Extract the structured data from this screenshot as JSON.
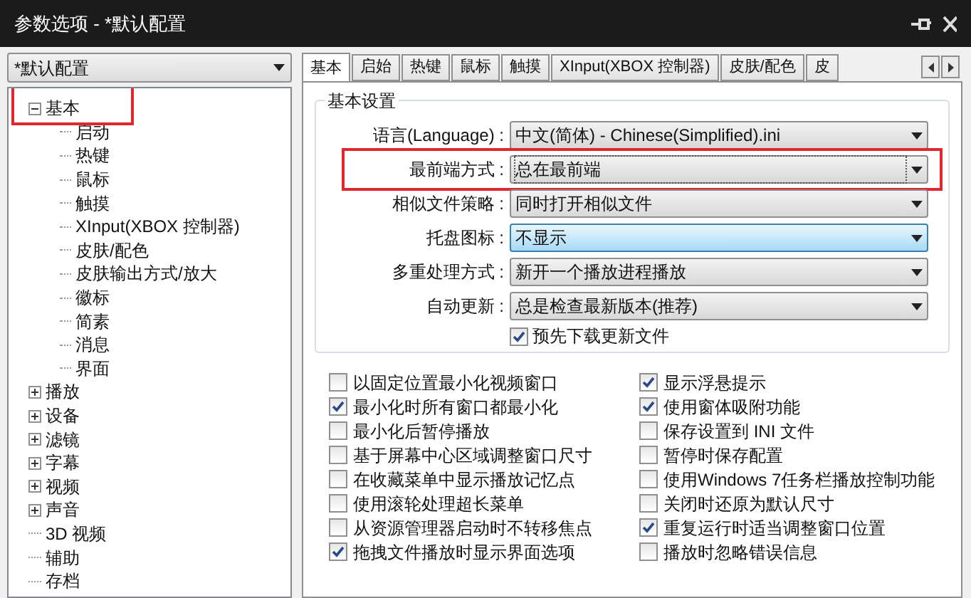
{
  "window": {
    "title": "参数选项 - *默认配置"
  },
  "profile": {
    "value": "*默认配置"
  },
  "tree": [
    {
      "label": "基本",
      "expanded": true,
      "highlighted": true,
      "children": [
        {
          "label": "启动"
        },
        {
          "label": "热键"
        },
        {
          "label": "鼠标"
        },
        {
          "label": "触摸"
        },
        {
          "label": "XInput(XBOX 控制器)"
        },
        {
          "label": "皮肤/配色"
        },
        {
          "label": "皮肤输出方式/放大"
        },
        {
          "label": "徽标"
        },
        {
          "label": "简素"
        },
        {
          "label": "消息"
        },
        {
          "label": "界面"
        }
      ]
    },
    {
      "label": "播放",
      "expanded": false,
      "highlighted": false
    },
    {
      "label": "设备",
      "expanded": false,
      "highlighted": false
    },
    {
      "label": "滤镜",
      "expanded": false,
      "highlighted": false
    },
    {
      "label": "字幕",
      "expanded": false,
      "highlighted": false
    },
    {
      "label": "视频",
      "expanded": false,
      "highlighted": false
    },
    {
      "label": "声音",
      "expanded": false,
      "highlighted": false
    },
    {
      "label": "3D 视频",
      "highlighted": false
    },
    {
      "label": "辅助",
      "highlighted": false
    },
    {
      "label": "存档",
      "highlighted": false
    }
  ],
  "tabs": [
    {
      "label": "基本",
      "selected": true
    },
    {
      "label": "启始",
      "selected": false
    },
    {
      "label": "热键",
      "selected": false
    },
    {
      "label": "鼠标",
      "selected": false
    },
    {
      "label": "触摸",
      "selected": false
    },
    {
      "label": "XInput(XBOX 控制器)",
      "selected": false
    },
    {
      "label": "皮肤/配色",
      "selected": false
    },
    {
      "label": "皮",
      "selected": false
    }
  ],
  "group": {
    "title": "基本设置",
    "settings": [
      {
        "label": "语言(Language) :",
        "value": "中文(简体) - Chinese(Simplified).ini",
        "highlighted": false,
        "hovered": false
      },
      {
        "label": "最前端方式 :",
        "value": "总在最前端",
        "highlighted": true,
        "hovered": false
      },
      {
        "label": "相似文件策略 :",
        "value": "同时打开相似文件",
        "highlighted": false,
        "hovered": false
      },
      {
        "label": "托盘图标 :",
        "value": "不显示",
        "highlighted": false,
        "hovered": true
      },
      {
        "label": "多重处理方式 :",
        "value": "新开一个播放进程播放",
        "highlighted": false,
        "hovered": false
      },
      {
        "label": "自动更新 :",
        "value": "总是检查最新版本(推荐)",
        "highlighted": false,
        "hovered": false
      }
    ],
    "update_checkbox": {
      "label": "预先下载更新文件",
      "checked": true
    }
  },
  "options": [
    {
      "label": "以固定位置最小化视频窗口",
      "checked": false
    },
    {
      "label": "显示浮悬提示",
      "checked": true
    },
    {
      "label": "最小化时所有窗口都最小化",
      "checked": true
    },
    {
      "label": "使用窗体吸附功能",
      "checked": true
    },
    {
      "label": "最小化后暂停播放",
      "checked": false
    },
    {
      "label": "保存设置到 INI 文件",
      "checked": false
    },
    {
      "label": "基于屏幕中心区域调整窗口尺寸",
      "checked": false
    },
    {
      "label": "暂停时保存配置",
      "checked": false
    },
    {
      "label": "在收藏菜单中显示播放记忆点",
      "checked": false
    },
    {
      "label": "使用Windows 7任务栏播放控制功能",
      "checked": false
    },
    {
      "label": "使用滚轮处理超长菜单",
      "checked": false
    },
    {
      "label": "关闭时还原为默认尺寸",
      "checked": false
    },
    {
      "label": "从资源管理器启动时不转移焦点",
      "checked": false
    },
    {
      "label": "重复运行时适当调整窗口位置",
      "checked": true
    },
    {
      "label": "拖拽文件播放时显示界面选项",
      "checked": true
    },
    {
      "label": "播放时忽略错误信息",
      "checked": false
    }
  ]
}
